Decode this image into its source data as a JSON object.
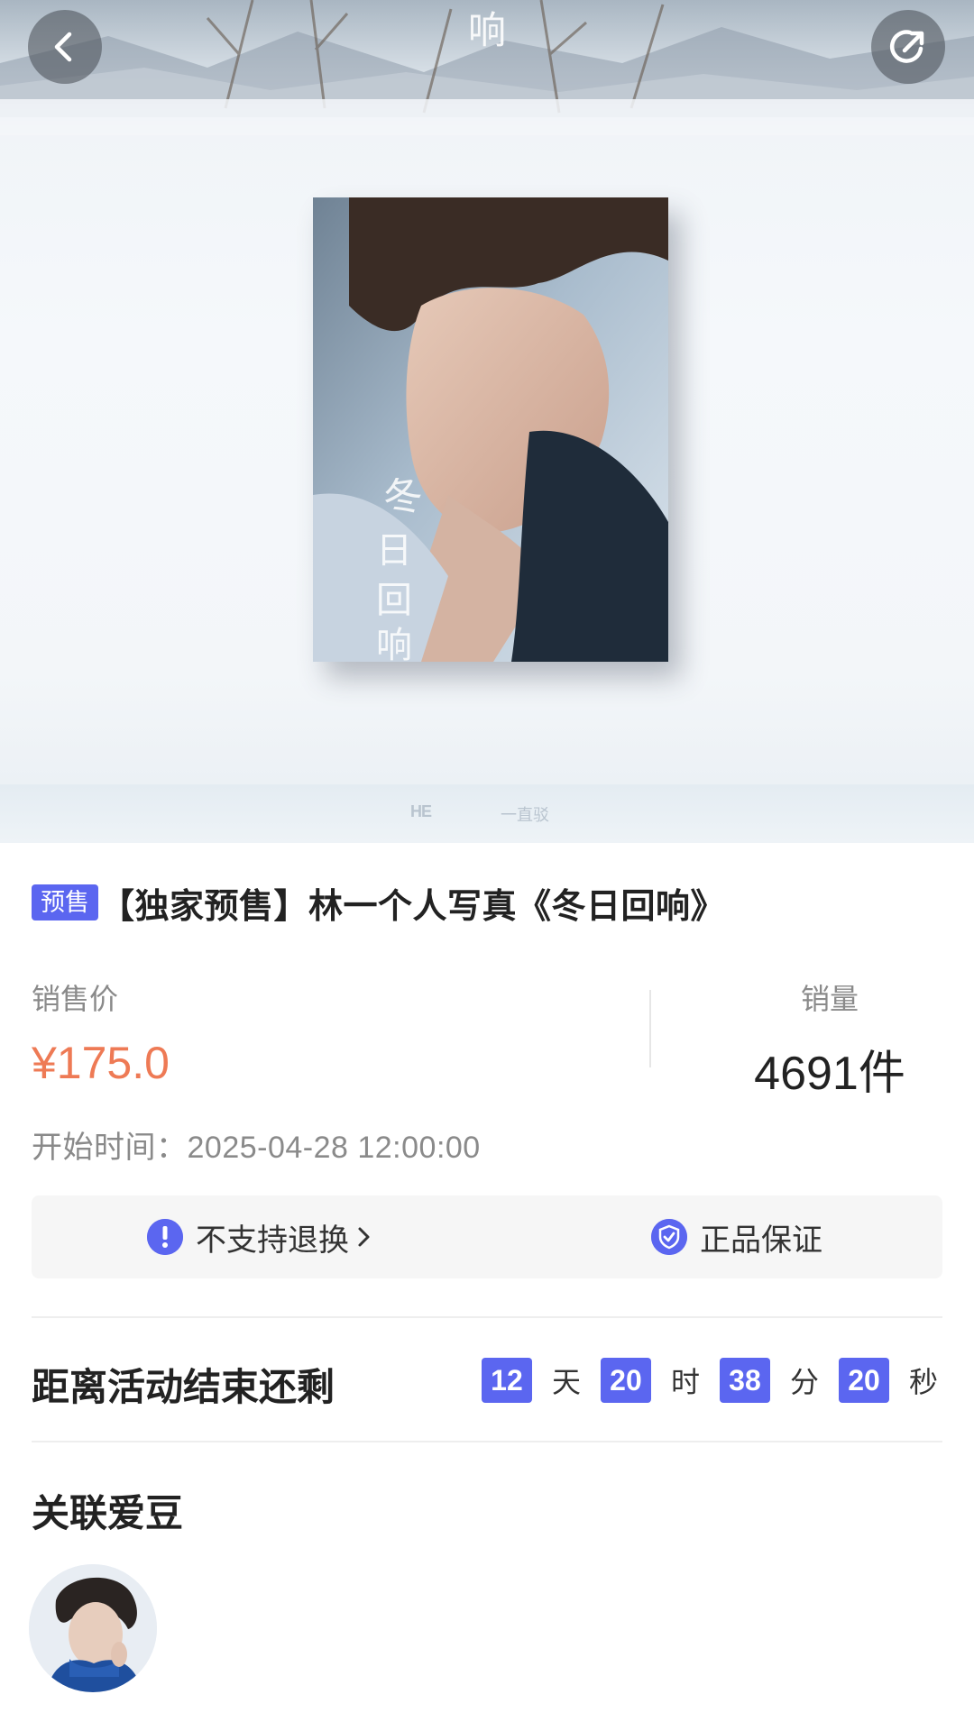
{
  "product": {
    "tag": "预售",
    "title": "【独家预售】林一个人写真《冬日回响》",
    "cover_text": "冬日回响"
  },
  "hero": {
    "brand_left": "HE",
    "brand_right": "一直驳"
  },
  "price": {
    "label": "销售价",
    "value": "¥175.0"
  },
  "sales": {
    "label": "销量",
    "value": "4691件"
  },
  "start_time": "开始时间：2025-04-28 12:00:00",
  "services": {
    "no_return": "不支持退换",
    "genuine": "正品保证"
  },
  "countdown": {
    "label": "距离活动结束还剩",
    "days": "12",
    "days_unit": "天",
    "hours": "20",
    "hours_unit": "时",
    "minutes": "38",
    "minutes_unit": "分",
    "seconds": "20",
    "seconds_unit": "秒"
  },
  "idols": {
    "heading": "关联爱豆"
  },
  "colors": {
    "accent": "#5b66f0",
    "price": "#ee7a55"
  }
}
